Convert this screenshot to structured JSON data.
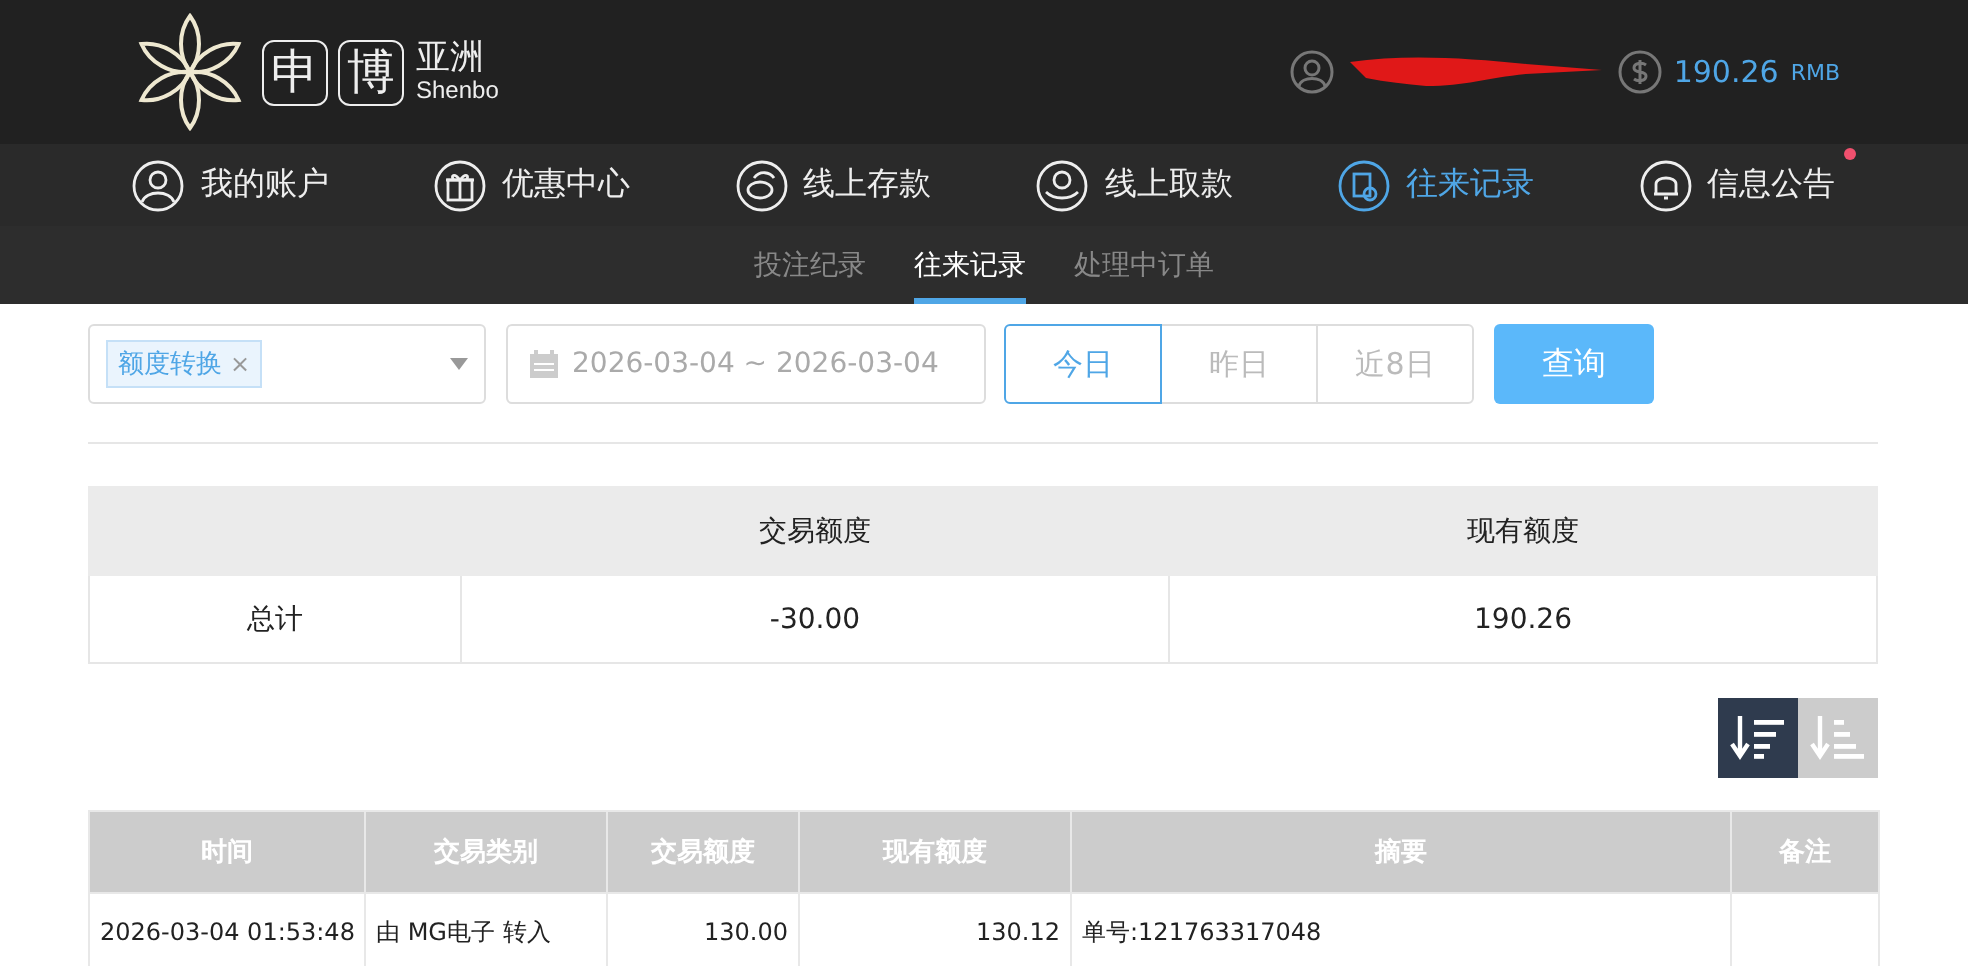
{
  "header": {
    "logo": {
      "chars": [
        "申",
        "博"
      ],
      "name_cn": "亚洲",
      "name_en": "Shenbo"
    },
    "balance": {
      "amount": "190.26",
      "currency": "RMB"
    }
  },
  "nav": [
    {
      "label": "我的账户",
      "kind": "user",
      "selected": false,
      "unread": false
    },
    {
      "label": "优惠中心",
      "kind": "gift",
      "selected": false,
      "unread": false
    },
    {
      "label": "线上存款",
      "kind": "deposit",
      "selected": false,
      "unread": false
    },
    {
      "label": "线上取款",
      "kind": "withdraw",
      "selected": false,
      "unread": false
    },
    {
      "label": "往来记录",
      "kind": "record",
      "selected": true,
      "unread": false
    },
    {
      "label": "信息公告",
      "kind": "bell",
      "selected": false,
      "unread": true
    }
  ],
  "subnav": [
    {
      "label": "投注纪录",
      "selected": false
    },
    {
      "label": "往来记录",
      "selected": true
    },
    {
      "label": "处理中订单",
      "selected": false
    }
  ],
  "filter": {
    "tag": "额度转换",
    "tag_close": "×",
    "date_range": "2026-03-04 ~ 2026-03-04",
    "quick": [
      {
        "label": "今日",
        "selected": true
      },
      {
        "label": "昨日",
        "selected": false
      },
      {
        "label": "近8日",
        "selected": false
      }
    ],
    "query_button": "查询"
  },
  "summary": {
    "columns": [
      "交易额度",
      "现有额度"
    ],
    "row": {
      "label": "总计",
      "amount": "-30.00",
      "balance": "190.26"
    }
  },
  "sort": [
    {
      "kind": "desc",
      "selected": true
    },
    {
      "kind": "asc",
      "selected": false
    }
  ],
  "table": {
    "columns": [
      "时间",
      "交易类别",
      "交易额度",
      "现有额度",
      "摘要",
      "备注"
    ],
    "rows": [
      [
        "2026-03-04 01:53:48",
        "由 MG电子 转入",
        "130.00",
        "130.12",
        "单号:121763317048",
        ""
      ]
    ]
  }
}
